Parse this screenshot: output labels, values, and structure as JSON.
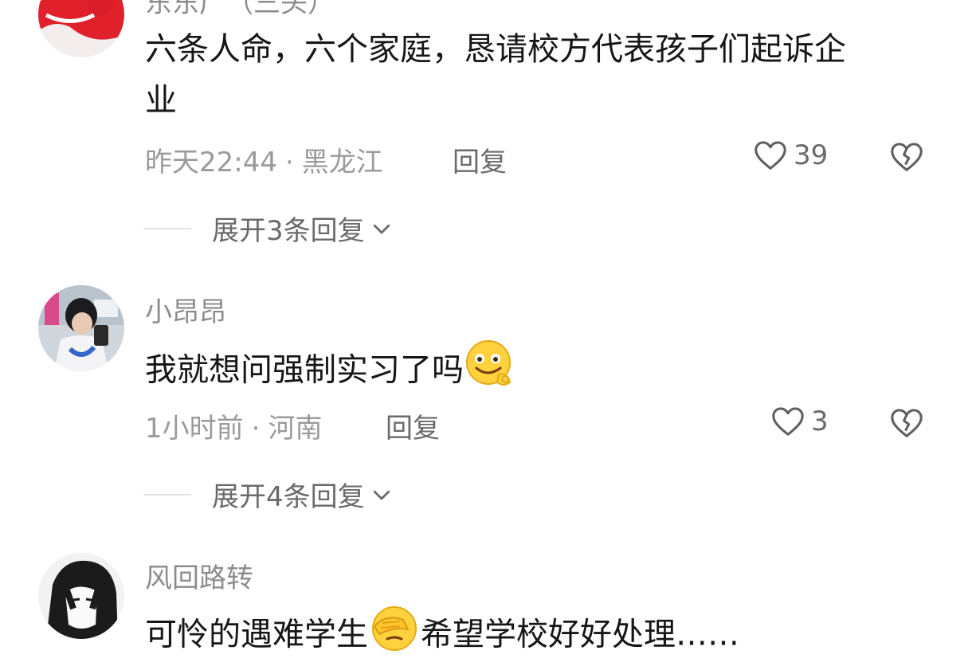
{
  "comments": [
    {
      "username": "东东广（三头）",
      "content_line1": "六条人命，六个家庭，恳请校方代表孩子们起诉企",
      "content_line2": "业",
      "time": "昨天22:44",
      "dot": "·",
      "location": "黑龙江",
      "reply_label": "回复",
      "likes": "39",
      "expand_label": "展开3条回复"
    },
    {
      "username": "小昂昂",
      "content": "我就想问强制实习了吗",
      "emoji_name": "smile-ok-emoji",
      "time": "1小时前",
      "dot": "·",
      "location": "河南",
      "reply_label": "回复",
      "likes": "3",
      "expand_label": "展开4条回复"
    },
    {
      "username": "风回路转",
      "content_before": "可怜的遇难学生",
      "emoji_name": "facepalm-emoji",
      "content_after": "希望学校好好处理……"
    }
  ],
  "colors": {
    "text": "#161616",
    "meta": "#9a9a9a",
    "secondary": "#6a6a6a",
    "divider": "#e3e3e3"
  }
}
